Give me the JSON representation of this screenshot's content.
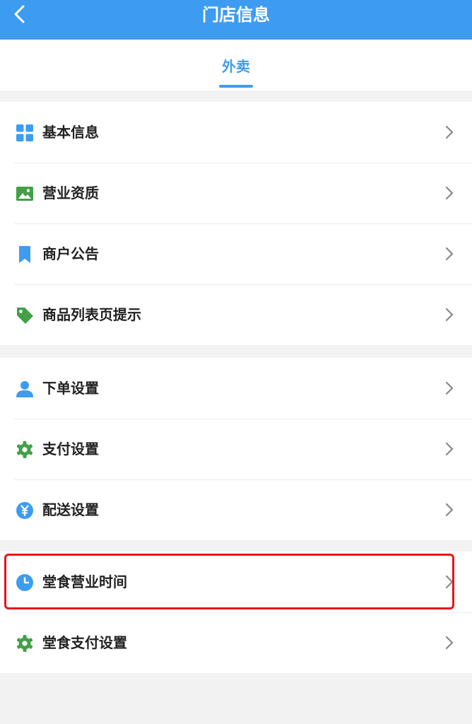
{
  "header": {
    "title": "门店信息",
    "back_icon": "chevron-left-icon"
  },
  "tabs": [
    {
      "label": "外卖",
      "active": true
    }
  ],
  "groups": [
    {
      "items": [
        {
          "label": "基本信息",
          "icon": "grid-icon",
          "icon_color": "#3d9cf0"
        },
        {
          "label": "营业资质",
          "icon": "image-icon",
          "icon_color": "#43a047"
        },
        {
          "label": "商户公告",
          "icon": "bookmark-icon",
          "icon_color": "#3d9cf0"
        },
        {
          "label": "商品列表页提示",
          "icon": "tag-icon",
          "icon_color": "#43a047"
        }
      ]
    },
    {
      "items": [
        {
          "label": "下单设置",
          "icon": "person-icon",
          "icon_color": "#3d9cf0"
        },
        {
          "label": "支付设置",
          "icon": "gear-icon",
          "icon_color": "#43a047"
        },
        {
          "label": "配送设置",
          "icon": "yen-icon",
          "icon_color": "#3d9cf0"
        }
      ]
    },
    {
      "items": [
        {
          "label": "堂食营业时间",
          "icon": "clock-icon",
          "icon_color": "#3d9cf0",
          "highlighted": true
        },
        {
          "label": "堂食支付设置",
          "icon": "gear-icon",
          "icon_color": "#43a047"
        }
      ]
    }
  ],
  "colors": {
    "accent": "#3d9cf0",
    "green": "#43a047",
    "highlight": "#e8141a"
  }
}
